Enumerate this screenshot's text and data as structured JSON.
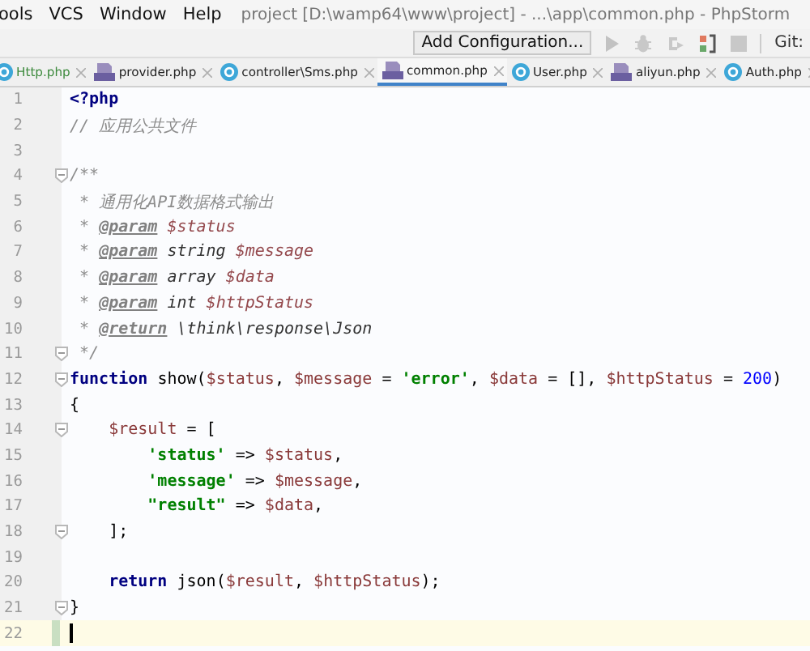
{
  "menu": [
    "ools",
    "VCS",
    "Window",
    "Help"
  ],
  "window": {
    "title": "project [D:\\wamp64\\www\\project] - ...\\app\\common.php - PhpStorm"
  },
  "toolbar": {
    "config_button": "Add Configuration...",
    "vcs_label": "Git:"
  },
  "tabs": [
    {
      "label": "Http.php",
      "kind": "class",
      "selected": false
    },
    {
      "label": "provider.php",
      "kind": "php",
      "selected": false
    },
    {
      "label": "controller\\Sms.php",
      "kind": "class",
      "selected": false
    },
    {
      "label": "common.php",
      "kind": "php",
      "selected": true
    },
    {
      "label": "User.php",
      "kind": "class",
      "selected": false
    },
    {
      "label": "aliyun.php",
      "kind": "php",
      "selected": false
    },
    {
      "label": "Auth.php",
      "kind": "class",
      "selected": false
    }
  ],
  "lines": [
    {
      "number": "1",
      "fold": false,
      "current": false,
      "tokens": [
        {
          "kind": "tag",
          "text": "<?php"
        }
      ]
    },
    {
      "number": "2",
      "fold": false,
      "current": false,
      "tokens": [
        {
          "kind": "comment",
          "text": "// 应用公共文件"
        }
      ]
    },
    {
      "number": "3",
      "fold": false,
      "current": false
    },
    {
      "number": "4",
      "fold": true,
      "current": false,
      "tokens": [
        {
          "kind": "comment",
          "text": "/**"
        }
      ]
    },
    {
      "number": "5",
      "fold": false,
      "current": false,
      "tokens": [
        {
          "kind": "comment",
          "text": " * 通用化API数据格式输出"
        }
      ]
    },
    {
      "number": "6",
      "fold": false,
      "current": false,
      "tokens": [
        {
          "kind": "comment",
          "text": " * "
        },
        {
          "kind": "doctag",
          "text": "@param"
        },
        {
          "kind": "docvar",
          "text": " $status"
        }
      ]
    },
    {
      "number": "7",
      "fold": false,
      "current": false,
      "tokens": [
        {
          "kind": "comment",
          "text": " * "
        },
        {
          "kind": "doctag",
          "text": "@param"
        },
        {
          "kind": "doctype",
          "text": " string"
        },
        {
          "kind": "docvar",
          "text": " $message"
        }
      ]
    },
    {
      "number": "8",
      "fold": false,
      "current": false,
      "tokens": [
        {
          "kind": "comment",
          "text": " * "
        },
        {
          "kind": "doctag",
          "text": "@param"
        },
        {
          "kind": "doctype",
          "text": " array"
        },
        {
          "kind": "docvar",
          "text": " $data"
        }
      ]
    },
    {
      "number": "9",
      "fold": false,
      "current": false,
      "tokens": [
        {
          "kind": "comment",
          "text": " * "
        },
        {
          "kind": "doctag",
          "text": "@param"
        },
        {
          "kind": "doctype",
          "text": " int"
        },
        {
          "kind": "docvar",
          "text": " $httpStatus"
        }
      ]
    },
    {
      "number": "10",
      "fold": false,
      "current": false,
      "tokens": [
        {
          "kind": "comment",
          "text": " * "
        },
        {
          "kind": "doctag",
          "text": "@return"
        },
        {
          "kind": "doctype",
          "text": " \\think\\response\\Json"
        }
      ]
    },
    {
      "number": "11",
      "fold": true,
      "current": false,
      "tokens": [
        {
          "kind": "comment",
          "text": " */"
        }
      ]
    },
    {
      "number": "12",
      "fold": true,
      "current": false,
      "tokens": [
        {
          "kind": "keyword",
          "text": "function"
        },
        {
          "kind": "plain",
          "text": " show("
        },
        {
          "kind": "var",
          "text": "$status"
        },
        {
          "kind": "plain",
          "text": ", "
        },
        {
          "kind": "var",
          "text": "$message"
        },
        {
          "kind": "plain",
          "text": " = "
        },
        {
          "kind": "string",
          "text": "'error'"
        },
        {
          "kind": "plain",
          "text": ", "
        },
        {
          "kind": "var",
          "text": "$data"
        },
        {
          "kind": "plain",
          "text": " = [], "
        },
        {
          "kind": "var",
          "text": "$httpStatus"
        },
        {
          "kind": "plain",
          "text": " = "
        },
        {
          "kind": "number",
          "text": "200"
        },
        {
          "kind": "plain",
          "text": ")"
        }
      ]
    },
    {
      "number": "13",
      "fold": false,
      "current": false,
      "tokens": [
        {
          "kind": "plain",
          "text": "{"
        }
      ]
    },
    {
      "number": "14",
      "fold": true,
      "current": false,
      "tokens": [
        {
          "kind": "var",
          "text": "    $result"
        },
        {
          "kind": "plain",
          "text": " = ["
        }
      ]
    },
    {
      "number": "15",
      "fold": false,
      "current": false,
      "tokens": [
        {
          "kind": "string",
          "text": "        'status'"
        },
        {
          "kind": "plain",
          "text": " => "
        },
        {
          "kind": "var",
          "text": "$status"
        },
        {
          "kind": "plain",
          "text": ","
        }
      ]
    },
    {
      "number": "16",
      "fold": false,
      "current": false,
      "tokens": [
        {
          "kind": "string",
          "text": "        'message'"
        },
        {
          "kind": "plain",
          "text": " => "
        },
        {
          "kind": "var",
          "text": "$message"
        },
        {
          "kind": "plain",
          "text": ","
        }
      ]
    },
    {
      "number": "17",
      "fold": false,
      "current": false,
      "tokens": [
        {
          "kind": "string",
          "text": "        \"result\""
        },
        {
          "kind": "plain",
          "text": " => "
        },
        {
          "kind": "var",
          "text": "$data"
        },
        {
          "kind": "plain",
          "text": ","
        }
      ]
    },
    {
      "number": "18",
      "fold": true,
      "current": false,
      "tokens": [
        {
          "kind": "plain",
          "text": "    ];"
        }
      ]
    },
    {
      "number": "19",
      "fold": false,
      "current": false
    },
    {
      "number": "20",
      "fold": false,
      "current": false,
      "tokens": [
        {
          "kind": "keyword",
          "text": "    return"
        },
        {
          "kind": "plain",
          "text": " json("
        },
        {
          "kind": "var",
          "text": "$result"
        },
        {
          "kind": "plain",
          "text": ", "
        },
        {
          "kind": "var",
          "text": "$httpStatus"
        },
        {
          "kind": "plain",
          "text": ");"
        }
      ]
    },
    {
      "number": "21",
      "fold": true,
      "current": false,
      "tokens": [
        {
          "kind": "plain",
          "text": "}"
        }
      ]
    },
    {
      "number": "22",
      "fold": false,
      "current": true
    }
  ]
}
